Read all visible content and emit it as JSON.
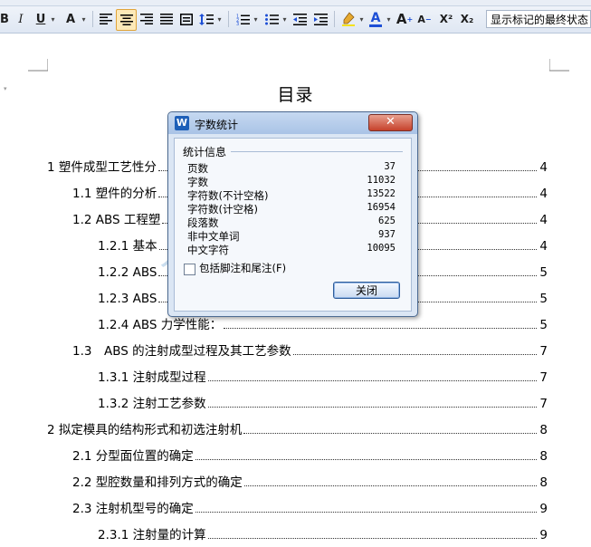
{
  "toolbar": {
    "bold": "B",
    "italic": "I",
    "underline": "U",
    "font_color_A": "A",
    "track_status": "显示标记的最终状态",
    "grow_font": "A",
    "shrink_font": "A",
    "superscript": "X²",
    "subscript": "X₂"
  },
  "document": {
    "title": "目录",
    "toc": [
      {
        "label": "1 塑件成型工艺性分",
        "page": "4"
      },
      {
        "label": "1.1 塑件的分析",
        "page": "4"
      },
      {
        "label": "1.2 ABS 工程塑",
        "page": "4"
      },
      {
        "label": "1.2.1 基本",
        "page": "4"
      },
      {
        "label": "1.2.2 ABS",
        "page": "5"
      },
      {
        "label": "1.2.3 ABS",
        "page": "5"
      },
      {
        "label": "1.2.4 ABS 力学性能：",
        "page": "5"
      },
      {
        "label": "1.3　ABS 的注射成型过程及其工艺参数",
        "page": "7"
      },
      {
        "label": "1.3.1 注射成型过程",
        "page": "7"
      },
      {
        "label": "1.3.2 注射工艺参数",
        "page": "7"
      },
      {
        "label": "2 拟定模具的结构形式和初选注射机",
        "page": "8"
      },
      {
        "label": "2.1 分型面位置的确定",
        "page": "8"
      },
      {
        "label": "2.2 型腔数量和排列方式的确定",
        "page": "8"
      },
      {
        "label": "2.3 注射机型号的确定",
        "page": "9"
      },
      {
        "label": "2.3.1 注射量的计算",
        "page": "9"
      }
    ]
  },
  "dialog": {
    "app_icon": "W",
    "title": "字数统计",
    "close_x": "✕",
    "group": "统计信息",
    "stats": [
      {
        "label": "页数",
        "value": "37"
      },
      {
        "label": "字数",
        "value": "11032"
      },
      {
        "label": "字符数(不计空格)",
        "value": "13522"
      },
      {
        "label": "字符数(计空格)",
        "value": "16954"
      },
      {
        "label": "段落数",
        "value": "625"
      },
      {
        "label": "非中文单词",
        "value": "937"
      },
      {
        "label": "中文字符",
        "value": "10095"
      }
    ],
    "checkbox_label": "包括脚注和尾注(F)",
    "close_button": "关闭"
  },
  "watermark": {
    "text1": "人人",
    "text2": "文库"
  },
  "colors": {
    "highlight": "#f5e11d",
    "font_color": "#1d4fd6",
    "accent": "#1d5fb8"
  }
}
